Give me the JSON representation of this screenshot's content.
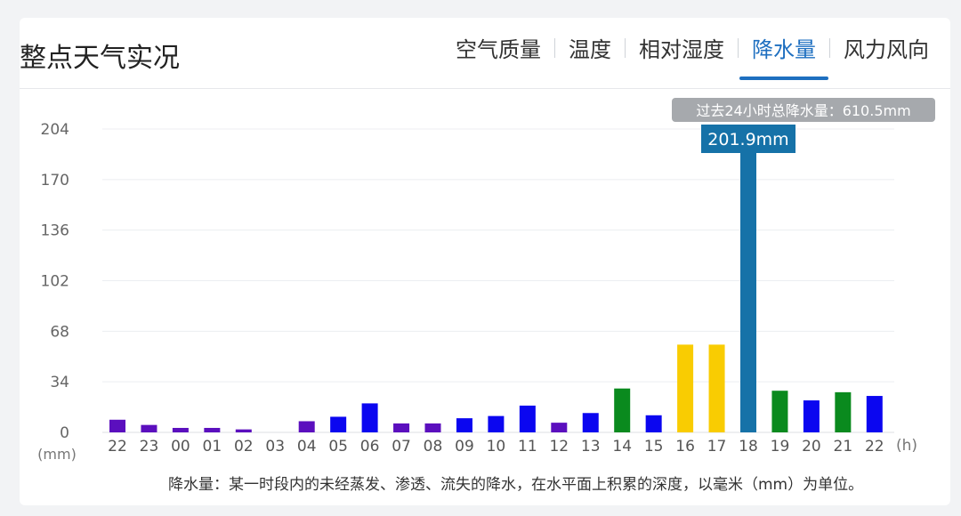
{
  "header": {
    "title": "整点天气实况",
    "tabs": [
      {
        "label": "空气质量",
        "active": false
      },
      {
        "label": "温度",
        "active": false
      },
      {
        "label": "相对湿度",
        "active": false
      },
      {
        "label": "降水量",
        "active": true
      },
      {
        "label": "风力风向",
        "active": false
      }
    ]
  },
  "chart_data": {
    "type": "bar",
    "categories": [
      "22",
      "23",
      "00",
      "01",
      "02",
      "03",
      "04",
      "05",
      "06",
      "07",
      "08",
      "09",
      "10",
      "11",
      "12",
      "13",
      "14",
      "15",
      "16",
      "17",
      "18",
      "19",
      "20",
      "21",
      "22"
    ],
    "values": [
      8.5,
      5,
      3,
      3,
      2,
      0,
      7.5,
      10.5,
      19.5,
      6,
      6,
      9.5,
      11,
      18,
      6.5,
      13,
      29.5,
      11.5,
      59,
      59,
      201.9,
      28,
      21.5,
      27,
      24.5
    ],
    "colors": [
      "#5b0fbe",
      "#5b0fbe",
      "#5b0fbe",
      "#5b0fbe",
      "#5b0fbe",
      "#5b0fbe",
      "#5b0fbe",
      "#0b06f0",
      "#0b06f0",
      "#5b0fbe",
      "#5b0fbe",
      "#0b06f0",
      "#0b06f0",
      "#0b06f0",
      "#5b0fbe",
      "#0b06f0",
      "#0a8a1e",
      "#0b06f0",
      "#f9cc02",
      "#f9cc02",
      "#1672a8",
      "#0a8a1e",
      "#0b06f0",
      "#0a8a1e",
      "#0b06f0"
    ],
    "y_ticks": [
      "0",
      "34",
      "68",
      "102",
      "136",
      "170",
      "204"
    ],
    "ylim": [
      0,
      204
    ],
    "y_unit": "(mm)",
    "x_unit": "(h)",
    "highlight": {
      "index": 20,
      "label": "201.9mm"
    },
    "total_label": "过去24小时总降水量：610.5mm",
    "grid": true
  },
  "footnote": "降水量：某一时段内的未经蒸发、渗透、流失的降水，在水平面上积累的深度，以毫米（mm）为单位。"
}
